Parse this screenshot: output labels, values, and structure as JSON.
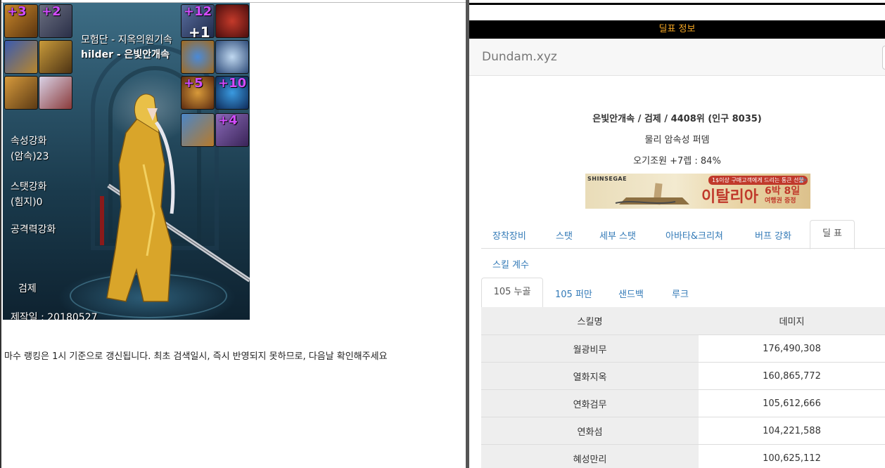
{
  "character": {
    "guild_line": "모험단 - 지옥의원기속",
    "name_line": "hilder - 은빛안개속",
    "element_enhance_label": "속성강화",
    "element_enhance_value": "(암속)23",
    "stat_enhance_label": "스탯강화",
    "stat_enhance_value": "(힘지)0",
    "attack_enhance_label": "공격력강화",
    "class_label": "검제",
    "created_date": "제작일 : 20180527",
    "equipment_enchants": [
      "+3",
      "+2",
      "+12",
      "+1",
      "+5",
      "+10",
      "+4"
    ]
  },
  "notice": "마수 랭킹은 1시 기준으로 갱신됩니다. 최초 검색일시, 즉시 반영되지 못하므로, 다음날 확인해주세요",
  "right": {
    "header_title": "딜표 정보",
    "brand": "Dundam.xyz",
    "info_line1": "은빛안개속 / 검제 / 4408위 (인구 8035)",
    "info_line2": "물리 암속성 퍼뎀",
    "info_line3": "오기조원 +7렙 : 84%",
    "ad": {
      "brand": "SHINSEGAE",
      "promo": "1$이상 구매고객에게 드리는 통큰 선물",
      "headline": "이탈리아",
      "trip": "6박 8일",
      "sub": "여행권 증정",
      "choice_mark": "▷"
    },
    "tabs_main": [
      "장착장비",
      "스탯",
      "세부 스탯",
      "아바타&크리쳐",
      "버프 강화",
      "딜 표",
      "스킬 계수"
    ],
    "active_main_tab": "딜 표",
    "tabs_sub": [
      "105 누골",
      "105 퍼만",
      "샌드백",
      "루크"
    ],
    "active_sub_tab": "105 누골",
    "table": {
      "headers": [
        "스킬명",
        "데미지"
      ],
      "rows": [
        {
          "skill": "월광비무",
          "damage": "176,490,308"
        },
        {
          "skill": "열화지옥",
          "damage": "160,865,772"
        },
        {
          "skill": "연화검무",
          "damage": "105,612,666"
        },
        {
          "skill": "연화섬",
          "damage": "104,221,588"
        },
        {
          "skill": "혜성만리",
          "damage": "100,625,112"
        }
      ]
    }
  },
  "colors": {
    "header_bg": "#000000",
    "header_text": "#f5a623",
    "link": "#337ab7",
    "enchant": "#d24cff",
    "table_name_bg": "#eeeeee"
  }
}
